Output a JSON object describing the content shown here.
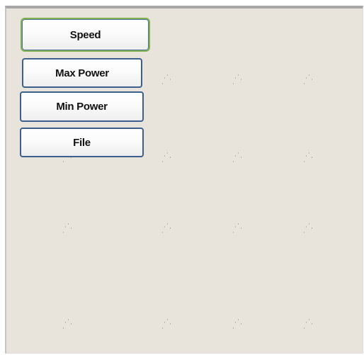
{
  "menu": {
    "buttons": [
      {
        "label": "Speed",
        "selected": true
      },
      {
        "label": "Max Power",
        "selected": false
      },
      {
        "label": "Min Power",
        "selected": false
      },
      {
        "label": "File",
        "selected": false
      }
    ]
  },
  "colors": {
    "panel_background": "#e8e4dc",
    "button_border": "#3d5f8e",
    "selected_outline": "#7fb24f"
  }
}
